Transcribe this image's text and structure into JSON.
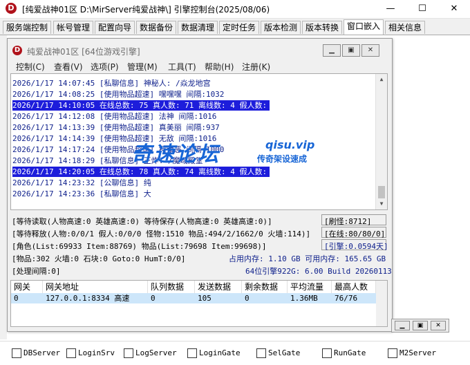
{
  "window": {
    "icon": "D",
    "title": "[纯爱战神01区 D:\\MirServer纯爱战神\\] 引擎控制台(2025/08/06)",
    "minimize": "—",
    "maximize": "☐",
    "close": "✕"
  },
  "tabs": [
    {
      "label": "服务端控制"
    },
    {
      "label": "帐号管理"
    },
    {
      "label": "配置向导"
    },
    {
      "label": "数据备份"
    },
    {
      "label": "数据清理"
    },
    {
      "label": "定时任务"
    },
    {
      "label": "版本检测"
    },
    {
      "label": "版本转换"
    },
    {
      "label": "窗口嵌入",
      "active": true
    },
    {
      "label": "相关信息"
    }
  ],
  "inner_window": {
    "icon": "D",
    "title": "纯爱战神01区 [64位游戏引擎]",
    "minimize": "▁",
    "maximize": "▣",
    "close": "✕",
    "menu": [
      "控制(C)",
      "查看(V)",
      "选项(P)",
      "管理(M)",
      "工具(T)",
      "帮助(H)",
      "注册(K)"
    ]
  },
  "log": [
    {
      "text": "2026/1/17 14:07:45 [私聊信息] 神秘人: /焱龙地宫",
      "highlight": false
    },
    {
      "text": "2026/1/17 14:08:25 [使用物品超速] 嘿嘿嘿 间隔:1032",
      "highlight": false
    },
    {
      "text": "2026/1/17 14:10:05 在线总数: 75 真人数: 71 离线数: 4 假人数: 0",
      "highlight": true
    },
    {
      "text": "2026/1/17 14:12:08 [使用物品超速] 法神 间隔:1016",
      "highlight": false
    },
    {
      "text": "2026/1/17 14:13:39 [使用物品超速] 真美丽 间隔:937",
      "highlight": false
    },
    {
      "text": "2026/1/17 14:14:39 [使用物品超速] 无敌 间隔:1016",
      "highlight": false
    },
    {
      "text": "2026/1/17 14:17:24 [使用物品超速] 柯镇恶 间隔:1000",
      "highlight": false
    },
    {
      "text": "2026/1/17 14:18:29 [私聊信息] 王炸: /魔域殿堂",
      "highlight": false
    },
    {
      "text": "2026/1/17 14:20:05 在线总数: 78 真人数: 74 离线数: 4 假人数: 0",
      "highlight": true
    },
    {
      "text": "2026/1/17 14:23:32 [公聊信息] 纯",
      "highlight": false
    },
    {
      "text": "2026/1/17 14:23:36 [私聊信息] 大",
      "highlight": false
    }
  ],
  "watermark": {
    "main": "奇速论坛",
    "url": "qisu.vip",
    "sub": "传奇架设速成"
  },
  "status": {
    "line1": "[等待读取(人物高速:0 英雄高速:0) 等待保存(人物高速:0 英雄高速:0)]",
    "refresh": "[刷怪:8712]",
    "line2": "[等待释放(人物:0/0/1 假人:0/0/0 怪物:1510 物品:494/2/1662/0 火墙:114)]",
    "online": "[在线:80/80/0]",
    "line3": "[角色(List:69933 Item:88769) 物品(List:79698 Item:99698)]",
    "engine": "[引擎:0.0594天]",
    "line4": "[物品:302 火墙:0 石块:0 Goto:0 HumT:0/0]",
    "memory": "占用内存: 1.10 GB 可用内存: 165.65 GB",
    "line5": "[处理间隔:0]",
    "build": "64位引擎922G: 6.00 Build 20260113"
  },
  "gateway": {
    "columns": [
      "网关",
      "网关地址",
      "队列数据",
      "发送数据",
      "剩余数据",
      "平均流量",
      "最高人数"
    ],
    "rows": [
      [
        "0",
        "127.0.0.1:8334 高速",
        "0",
        "105",
        "0",
        "1.36MB",
        "76/76"
      ]
    ]
  },
  "mini_window": {
    "minimize": "▁",
    "maximize": "▣",
    "close": "✕"
  },
  "servers": [
    "DBServer",
    "LoginSrv",
    "LogServer",
    "LoginGate",
    "SelGate",
    "RunGate",
    "M2Server"
  ],
  "colors": {
    "highlight": "#1d1ddb",
    "log_text": "#0b1d8a",
    "selected_row": "#cde6fa",
    "watermark": "#1765d6",
    "app_icon": "#b0121b"
  }
}
